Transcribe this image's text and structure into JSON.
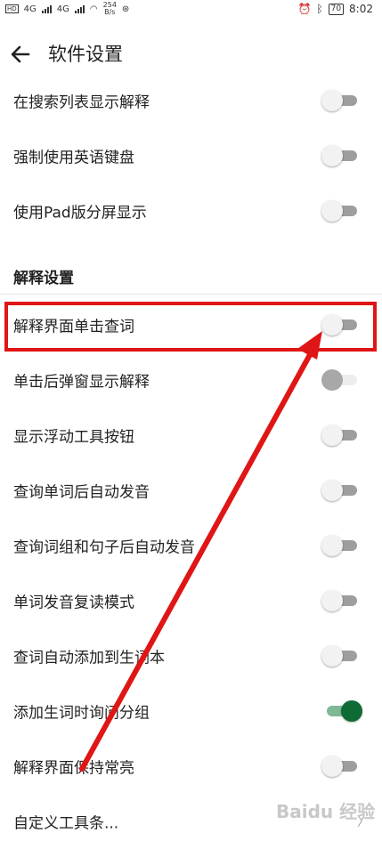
{
  "status": {
    "net1": "4G",
    "net2": "4G",
    "speed_value": "254",
    "speed_unit": "B/s",
    "battery": "70",
    "time": "8:02"
  },
  "header": {
    "title": "软件设置"
  },
  "rows_top": [
    {
      "label": "在搜索列表显示解释",
      "state": "off"
    },
    {
      "label": "强制使用英语键盘",
      "state": "off"
    },
    {
      "label": "使用Pad版分屏显示",
      "state": "off"
    }
  ],
  "section": {
    "title": "解释设置"
  },
  "rows_explain": [
    {
      "label": "解释界面单击查词",
      "state": "off"
    },
    {
      "label": "单击后弹窗显示解释",
      "state": "dim"
    },
    {
      "label": "显示浮动工具按钮",
      "state": "off"
    },
    {
      "label": "查询单词后自动发音",
      "state": "off"
    },
    {
      "label": "查询词组和句子后自动发音",
      "state": "off"
    },
    {
      "label": "单词发音复读模式",
      "state": "off"
    },
    {
      "label": "查词自动添加到生词本",
      "state": "off"
    },
    {
      "label": "添加生词时询问分组",
      "state": "on"
    },
    {
      "label": "解释界面保持常亮",
      "state": "off"
    }
  ],
  "custom_toolbar": {
    "label": "自定义工具条..."
  },
  "watermark": "Baidu 经验",
  "colors": {
    "highlight": "#e01515",
    "toggle_on": "#0d6b33"
  }
}
